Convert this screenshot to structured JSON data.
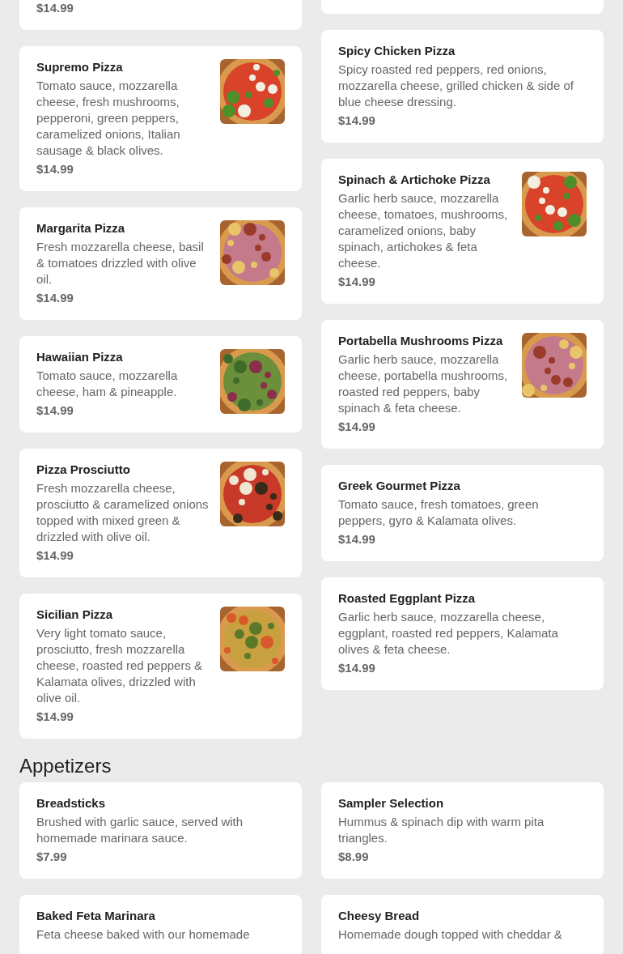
{
  "pizza_columns": [
    [
      {
        "kind": "cut",
        "price": "$14.99"
      },
      {
        "kind": "item",
        "name": "Supremo Pizza",
        "description": "Tomato sauce, mozzarella cheese, fresh mushrooms, pepperoni, green peppers, caramelized onions, Italian sausage & black olives.",
        "price": "$14.99"
      },
      {
        "kind": "item",
        "name": "Margarita Pizza",
        "description": "Fresh mozzarella cheese, basil & tomatoes drizzled with olive oil.",
        "price": "$14.99"
      },
      {
        "kind": "item",
        "name": "Hawaiian Pizza",
        "description": "Tomato sauce, mozzarella cheese, ham & pineapple.",
        "price": "$14.99"
      },
      {
        "kind": "item",
        "name": "Pizza Prosciutto",
        "description": "Fresh mozzarella cheese, prosciutto & caramelized onions topped with mixed green & drizzled with olive oil.",
        "price": "$14.99"
      },
      {
        "kind": "item",
        "name": "Sicilian Pizza",
        "description": "Very light tomato sauce, prosciutto, fresh mozzarella cheese, roasted red peppers & Kalamata olives, drizzled with olive oil.",
        "price": "$14.99"
      }
    ],
    [
      {
        "kind": "cut"
      },
      {
        "kind": "item",
        "name": "Spicy Chicken Pizza",
        "description": "Spicy roasted red peppers, red onions, mozzarella cheese, grilled chicken & side of blue cheese dressing.",
        "price": "$14.99"
      },
      {
        "kind": "item",
        "name": "Spinach & Artichoke Pizza",
        "description": "Garlic herb sauce, mozzarella cheese, tomatoes, mushrooms, caramelized onions, baby spinach, artichokes & feta cheese.",
        "price": "$14.99"
      },
      {
        "kind": "item",
        "name": "Portabella Mushrooms Pizza",
        "description": "Garlic herb sauce, mozzarella cheese, portabella mushrooms, roasted red peppers, baby spinach & feta cheese.",
        "price": "$14.99"
      },
      {
        "kind": "item",
        "name": "Greek Gourmet Pizza",
        "description": "Tomato sauce, fresh tomatoes, green peppers, gyro & Kalamata olives.",
        "price": "$14.99"
      },
      {
        "kind": "item",
        "name": "Roasted Eggplant Pizza",
        "description": "Garlic herb sauce, mozzarella cheese, eggplant, roasted red peppers, Kalamata olives & feta cheese.",
        "price": "$14.99"
      }
    ]
  ],
  "appetizers": {
    "title": "Appetizers",
    "items": [
      {
        "kind": "item",
        "name": "Breadsticks",
        "description": "Brushed with garlic sauce, served with homemade marinara sauce.",
        "price": "$7.99"
      },
      {
        "kind": "item",
        "name": "Sampler Selection",
        "description": "Hummus & spinach dip with warm pita triangles.",
        "price": "$8.99"
      },
      {
        "kind": "item",
        "name": "Baked Feta Marinara",
        "description": "Feta cheese baked with our homemade"
      },
      {
        "kind": "item",
        "name": "Cheesy Bread",
        "description": "Homemade dough topped with cheddar &"
      }
    ]
  }
}
